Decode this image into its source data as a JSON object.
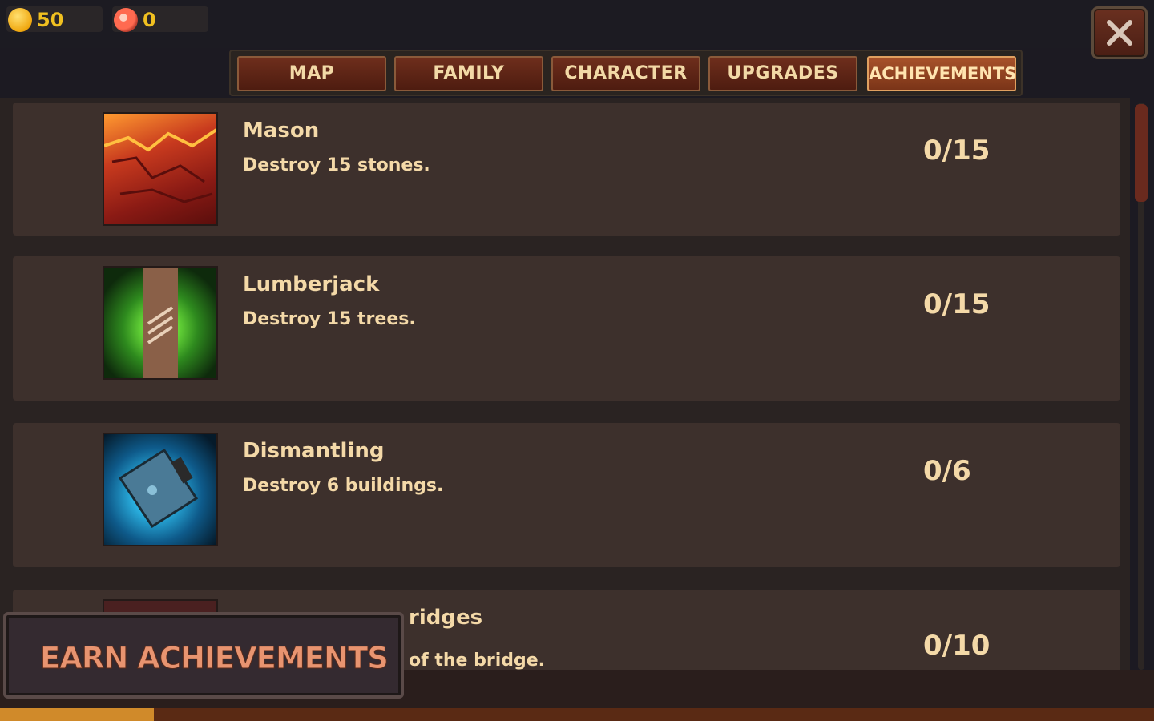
{
  "resources": {
    "coins": "50",
    "meat": "0"
  },
  "tabs": [
    {
      "label": "MAP"
    },
    {
      "label": "FAMILY"
    },
    {
      "label": "CHARACTER"
    },
    {
      "label": "UPGRADES"
    },
    {
      "label": "ACHIEVEMENTS",
      "active": true
    }
  ],
  "achievements": [
    {
      "title": "Mason",
      "description": "Destroy 15 stones.",
      "progress": "0/15",
      "icon": "lava-rock-icon"
    },
    {
      "title": "Lumberjack",
      "description": "Destroy 15 trees.",
      "progress": "0/15",
      "icon": "tree-trunk-icon"
    },
    {
      "title": "Dismantling",
      "description": "Destroy 6 buildings.",
      "progress": "0/6",
      "icon": "hammer-icon"
    },
    {
      "title": "ridges",
      "description": "of the bridge.",
      "progress": "0/10",
      "icon": "bridge-icon"
    }
  ],
  "banner": {
    "text": "EARN ACHIEVEMENTS"
  },
  "bottom_progress": 0.133,
  "colors": {
    "accent": "#f4d9a8",
    "coin": "#f0c020",
    "tab_active": "#a8522a",
    "banner_text": "#e89470"
  }
}
